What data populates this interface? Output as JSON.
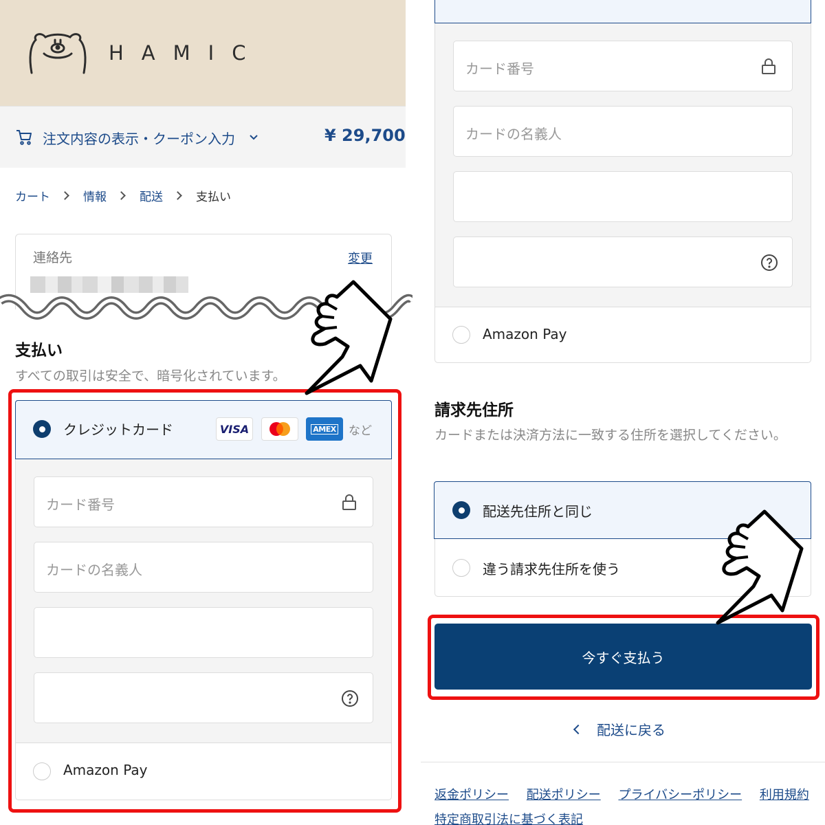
{
  "brand": {
    "name": "HAMIC",
    "logo_icon": "bear-face-icon"
  },
  "summary": {
    "label": "注文内容の表示・クーポン入力",
    "total": "¥ 29,700"
  },
  "breadcrumb": {
    "items": [
      "カート",
      "情報",
      "配送",
      "支払い"
    ]
  },
  "contact": {
    "label": "連絡先",
    "change": "変更"
  },
  "payment": {
    "heading": "支払い",
    "subtitle": "すべての取引は安全で、暗号化されています。",
    "credit_card": {
      "label": "クレジットカード",
      "badges": [
        "VISA",
        "AMEX"
      ],
      "more": "など"
    },
    "fields": {
      "card_number": "カード番号",
      "card_name": "カードの名義人"
    },
    "amazon_pay": "Amazon Pay"
  },
  "billing": {
    "heading": "請求先住所",
    "subtitle": "カードまたは決済方法に一致する住所を選択してください。",
    "options": [
      "配送先住所と同じ",
      "違う請求先住所を使う"
    ]
  },
  "actions": {
    "pay_now": "今すぐ支払う",
    "back": "配送に戻る"
  },
  "footer": {
    "links": [
      "返金ポリシー",
      "配送ポリシー",
      "プライバシーポリシー",
      "利用規約"
    ],
    "legal": "特定商取引法に基づく表記"
  },
  "colors": {
    "accent": "#1d4b8a",
    "button": "#0a4074",
    "highlight": "#ee1111",
    "brand_bg": "#eadfcd"
  }
}
